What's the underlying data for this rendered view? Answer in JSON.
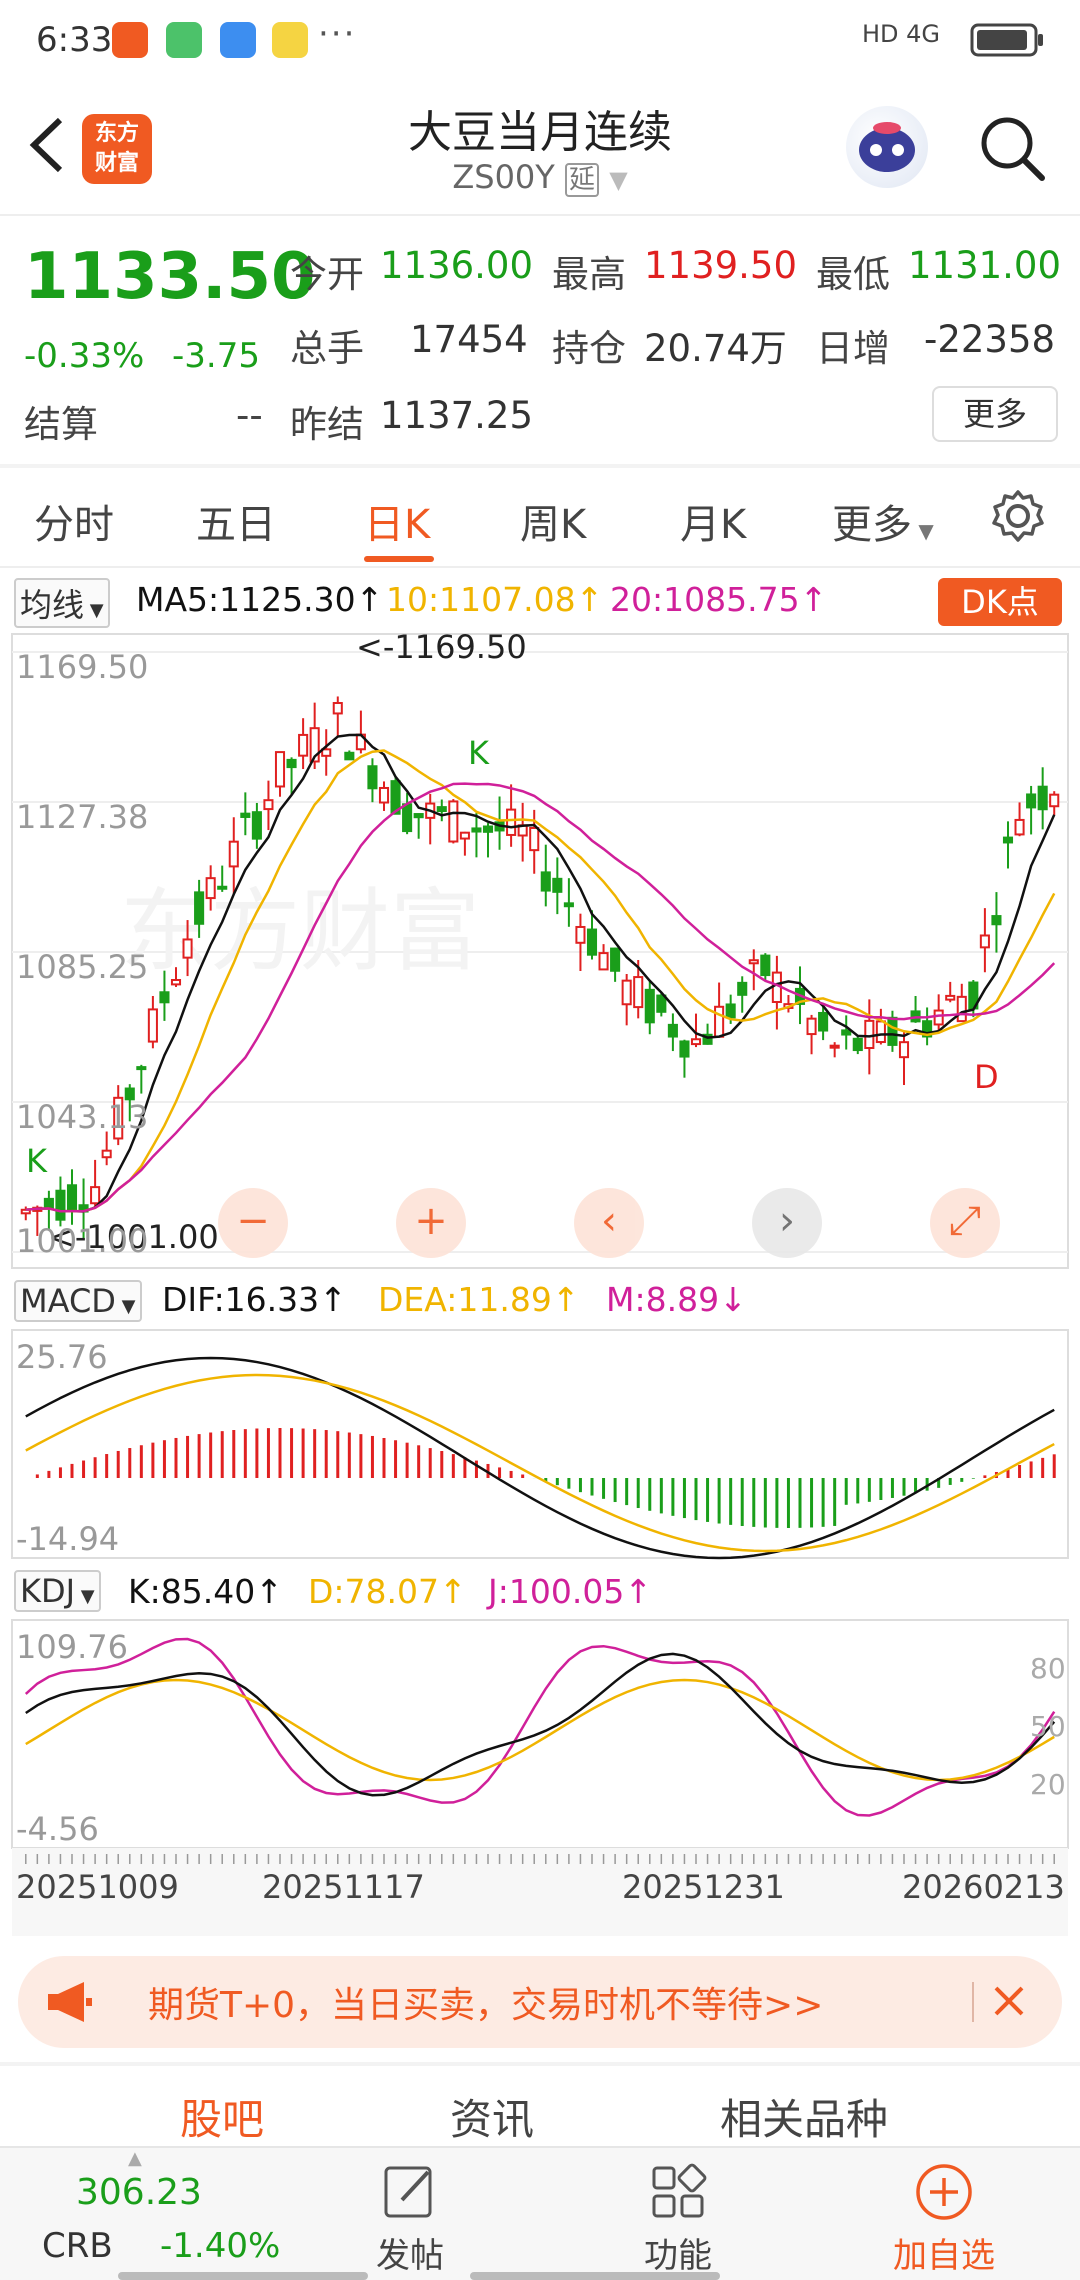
{
  "status_bar": {
    "time": "6:33",
    "network": "HD 4G"
  },
  "header": {
    "title": "大豆当月连续",
    "code": "ZS00Y",
    "delay_badge": "延",
    "logo_text": "东方财富"
  },
  "quote": {
    "price": "1133.50",
    "change_pct": "-0.33%",
    "change": "-3.75",
    "settle_label": "结算",
    "settle_value": "--",
    "open_label": "今开",
    "open": "1136.00",
    "high_label": "最高",
    "high": "1139.50",
    "low_label": "最低",
    "low": "1131.00",
    "volume_label": "总手",
    "volume": "17454",
    "oi_label": "持仓",
    "oi": "20.74万",
    "daily_inc_label": "日增",
    "daily_inc": "-22358",
    "prev_settle_label": "昨结",
    "prev_settle": "1137.25",
    "more_button": "更多"
  },
  "tabs": [
    "分时",
    "五日",
    "日K",
    "周K",
    "月K",
    "更多"
  ],
  "active_tab": "日K",
  "kline": {
    "indicator_button": "均线",
    "ma5": "MA5:1125.30",
    "ma10": "10:1107.08",
    "ma20": "20:1085.75",
    "dk_button": "DK点",
    "y_labels": [
      "1169.50",
      "1127.38",
      "1085.25",
      "1043.13",
      "1001.00"
    ],
    "max_marker": "<-1169.50",
    "min_marker": "<-1001.00",
    "k_marks": [
      "K",
      "K"
    ],
    "d_mark": "D",
    "tool_buttons": [
      "−",
      "+",
      "‹",
      "›",
      "⤢"
    ]
  },
  "macd": {
    "indicator_button": "MACD",
    "dif": "DIF:16.33",
    "dea": "DEA:11.89",
    "m": "M:8.89",
    "y_top": "25.76",
    "y_bottom": "-14.94"
  },
  "kdj": {
    "indicator_button": "KDJ",
    "k": "K:85.40",
    "d": "D:78.07",
    "j": "J:100.05",
    "y_top": "109.76",
    "y_bottom": "-4.56",
    "right_labels": [
      "80",
      "50",
      "20"
    ],
    "dates": [
      "20251009",
      "20251117",
      "20251231",
      "20260213"
    ]
  },
  "ad": {
    "text": "期货T+0，当日买卖，交易时机不等待>>"
  },
  "bottom_tabs": [
    "股吧",
    "资讯",
    "相关品种"
  ],
  "bottom_bar": {
    "index_value": "306.23",
    "index_name": "CRB",
    "index_change": "-1.40%",
    "post": "发帖",
    "function": "功能",
    "add_watch": "加自选"
  },
  "colors": {
    "up": "#e02020",
    "down": "#1a9e1a",
    "accent": "#f05a22",
    "ma5": "#111111",
    "ma10": "#f0b400",
    "ma20": "#d0209a"
  }
}
